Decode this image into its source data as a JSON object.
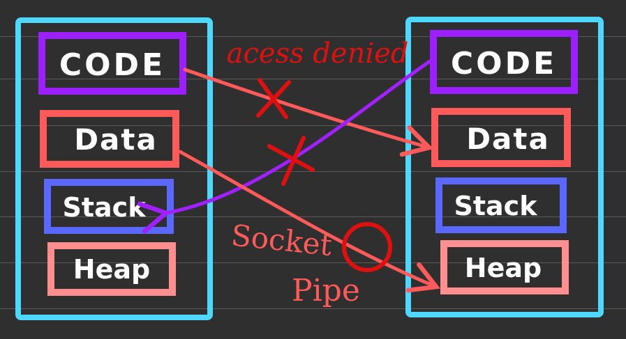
{
  "process_left": {
    "segments": [
      {
        "label": "CODE",
        "color": "#9b1fff"
      },
      {
        "label": "Data",
        "color": "#ff5a5a"
      },
      {
        "label": "Stack",
        "color": "#5a68ff"
      },
      {
        "label": "Heap",
        "color": "#ff8f8f"
      }
    ],
    "border_color": "#4fd8ff"
  },
  "process_right": {
    "segments": [
      {
        "label": "CODE",
        "color": "#9b1fff"
      },
      {
        "label": "Data",
        "color": "#ff5a5a"
      },
      {
        "label": "Stack",
        "color": "#5a68ff"
      },
      {
        "label": "Heap",
        "color": "#ff8f8f"
      }
    ],
    "border_color": "#4fd8ff"
  },
  "annotations": {
    "denied_label": "acess denied",
    "ipc_line1": "Socket",
    "ipc_line2": "Pipe"
  },
  "colors": {
    "background": "#2f2f2f",
    "denied_mark": "#e01010",
    "ipc_text": "#ff5a5a",
    "ok_mark": "#e01010",
    "arrow_code": "#a020ff",
    "arrow_data": "#ff5a5a"
  }
}
